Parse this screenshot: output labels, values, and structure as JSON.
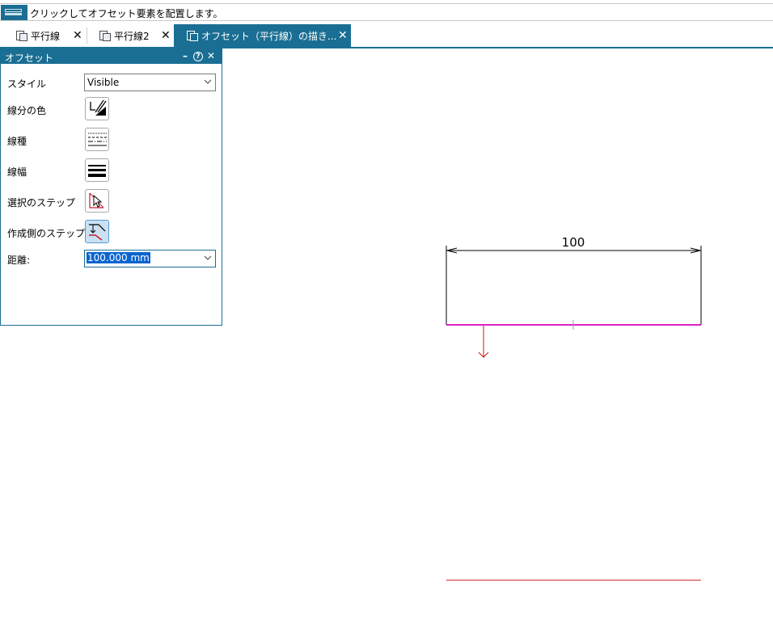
{
  "prompt": {
    "text": "クリックしてオフセット要素を配置します。"
  },
  "tabs": [
    {
      "label": "平行線",
      "icon": "document-icon",
      "close": "✕"
    },
    {
      "label": "平行線2",
      "icon": "document-icon",
      "close": "✕"
    },
    {
      "label": "オフセット（平行線）の描き...",
      "icon": "document-icon",
      "close": "✕",
      "active": true
    }
  ],
  "panel": {
    "title": "オフセット",
    "minimize": "–",
    "help": "?",
    "close": "✕",
    "rows": {
      "style_label": "スタイル",
      "style_value": "Visible",
      "color_label": "線分の色",
      "linetype_label": "線種",
      "linewidth_label": "線幅",
      "select_step_label": "選択のステップ",
      "create_side_label": "作成側のステップ",
      "distance_label": "距離:",
      "distance_value": "100.000 mm"
    }
  },
  "drawing": {
    "dimension_text": "100",
    "colors": {
      "selected_line": "#e020c8",
      "offset_line": "#d0181c",
      "arrow": "#c8141c",
      "geometry": "#000000"
    }
  }
}
